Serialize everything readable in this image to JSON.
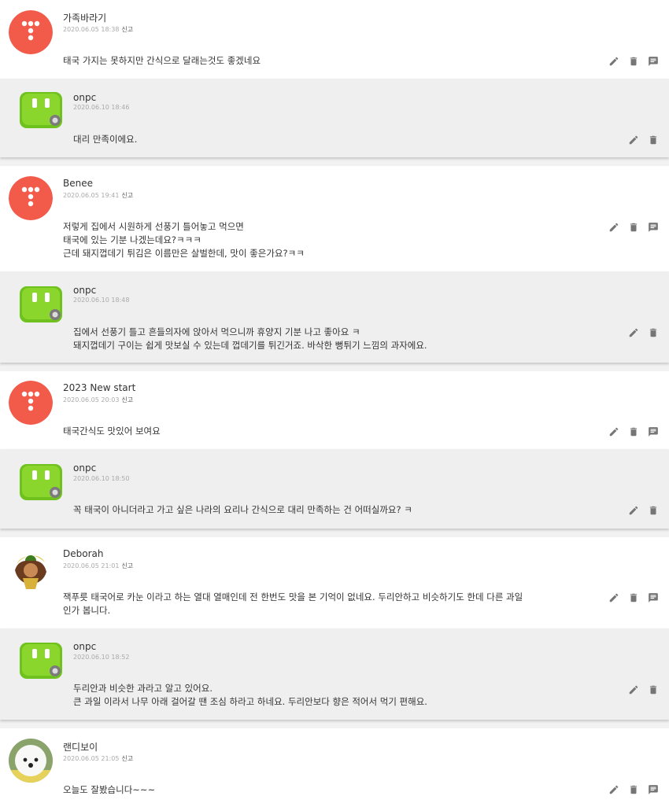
{
  "report_label": "신고",
  "threads": [
    {
      "comment": {
        "name": "가족바라기",
        "date": "2020.06.05 18:38",
        "text": "태국 가지는 못하지만 간식으로 달래는것도 좋겠네요",
        "avatar": "tistory-logo"
      },
      "reply": {
        "name": "onpc",
        "date": "2020.06.10 18:46",
        "text": "대리 만족이에요."
      }
    },
    {
      "comment": {
        "name": "Benee",
        "date": "2020.06.05 19:41",
        "text": "저렇게 집에서 시원하게 선풍기 틀어놓고 먹으면\n태국에 있는 기분 나겠는데요?ㅋㅋㅋ\n근데 돼지껍데기 튀김은 이름만은 살벌한데, 맛이 좋은가요?ㅋㅋ",
        "avatar": "tistory-logo"
      },
      "reply": {
        "name": "onpc",
        "date": "2020.06.10 18:48",
        "text": "집에서 선풍기 틀고 흔들의자에 앉아서 먹으니까 휴양지 기분 나고 좋아요 ㅋ\n돼지껍데기 구이는 쉽게 맛보실 수 있는데 껍데기를 튀긴거죠. 바삭한 뻥튀기 느낌의 과자에요."
      }
    },
    {
      "comment": {
        "name": "2023 New start",
        "date": "2020.06.05 20:03",
        "text": "태국간식도 맛있어 보여요",
        "avatar": "tistory-logo"
      },
      "reply": {
        "name": "onpc",
        "date": "2020.06.10 18:50",
        "text": "꼭 태국이 아니더라고 가고 싶은 나라의 요리나 간식으로 대리 만족하는 건 어떠실까요? ㅋ"
      }
    },
    {
      "comment": {
        "name": "Deborah",
        "date": "2020.06.05 21:01",
        "text": "잭푸릇 태국어로 카눈 이라고 하는 열대 열매인데 전 한번도 맛을 본 기억이 없네요. 두리안하고 비슷하기도 한데 다른 과일\n인가 봅니다.",
        "avatar": "cartoon-avatar"
      },
      "reply": {
        "name": "onpc",
        "date": "2020.06.10 18:52",
        "text": "두리안과 비슷한 과라고 알고 있어요.\n큰 과일 이라서 나무 아래 걸어갈 땐 조심 하라고 하네요. 두리안보다 향은 적어서 먹기 편해요."
      }
    },
    {
      "comment": {
        "name": "랜디보이",
        "date": "2020.06.05 21:05",
        "text": "오늘도 잘봤습니다~~~",
        "avatar": "dog-photo"
      }
    }
  ]
}
